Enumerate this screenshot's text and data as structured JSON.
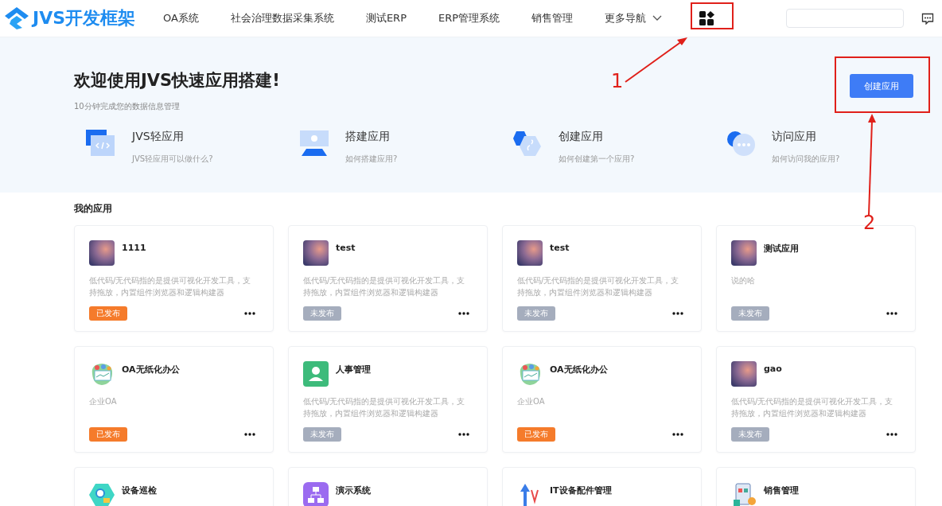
{
  "header": {
    "logo": "JVS开发框架",
    "nav": [
      {
        "kind": "link",
        "label": "OA系统"
      },
      {
        "kind": "link",
        "label": "社会治理数据采集系统"
      },
      {
        "kind": "link",
        "label": "测试ERP"
      },
      {
        "kind": "link",
        "label": "ERP管理系统"
      },
      {
        "kind": "link",
        "label": "销售管理"
      },
      {
        "kind": "dropdown",
        "label": "更多导航"
      }
    ]
  },
  "hero": {
    "title": "欢迎使用JVS快速应用搭建!",
    "subtitle": "10分钟完成您的数据信息管理",
    "button": "创建应用",
    "features": [
      {
        "kind": "code",
        "title": "JVS轻应用",
        "desc": "JVS轻应用可以做什么?"
      },
      {
        "kind": "monitor",
        "title": "搭建应用",
        "desc": "如何搭建应用?"
      },
      {
        "kind": "hexagon",
        "title": "创建应用",
        "desc": "如何创建第一个应用?"
      },
      {
        "kind": "chat",
        "title": "访问应用",
        "desc": "如何访问我的应用?"
      }
    ]
  },
  "apps": {
    "title": "我的应用",
    "cards": [
      {
        "kind": "gradient",
        "name": "1111",
        "desc": "低代码/无代码指的是提供可视化开发工具，支持拖放，内置组件浏览器和逻辑构建器",
        "status": "已发布",
        "published": true
      },
      {
        "kind": "gradient",
        "name": "test",
        "desc": "低代码/无代码指的是提供可视化开发工具，支持拖放，内置组件浏览器和逻辑构建器",
        "status": "未发布",
        "published": false
      },
      {
        "kind": "gradient",
        "name": "test",
        "desc": "低代码/无代码指的是提供可视化开发工具，支持拖放，内置组件浏览器和逻辑构建器",
        "status": "未发布",
        "published": false
      },
      {
        "kind": "gradient",
        "name": "测试应用",
        "desc": "说的哈",
        "status": "未发布",
        "published": false
      },
      {
        "kind": "office",
        "name": "OA无纸化办公",
        "desc": "企业OA",
        "status": "已发布",
        "published": true
      },
      {
        "kind": "person",
        "name": "人事管理",
        "desc": "低代码/无代码指的是提供可视化开发工具，支持拖放，内置组件浏览器和逻辑构建器",
        "status": "未发布",
        "published": false
      },
      {
        "kind": "office",
        "name": "OA无纸化办公",
        "desc": "企业OA",
        "status": "已发布",
        "published": true
      },
      {
        "kind": "gradient",
        "name": "gao",
        "desc": "低代码/无代码指的是提供可视化开发工具，支持拖放，内置组件浏览器和逻辑构建器",
        "status": "未发布",
        "published": false
      },
      {
        "kind": "device",
        "name": "设备巡检"
      },
      {
        "kind": "demo",
        "name": "演示系统"
      },
      {
        "kind": "it",
        "name": "IT设备配件管理"
      },
      {
        "kind": "sales",
        "name": "销售管理"
      }
    ]
  },
  "annotations": [
    {
      "text": "1"
    },
    {
      "text": "2"
    }
  ]
}
